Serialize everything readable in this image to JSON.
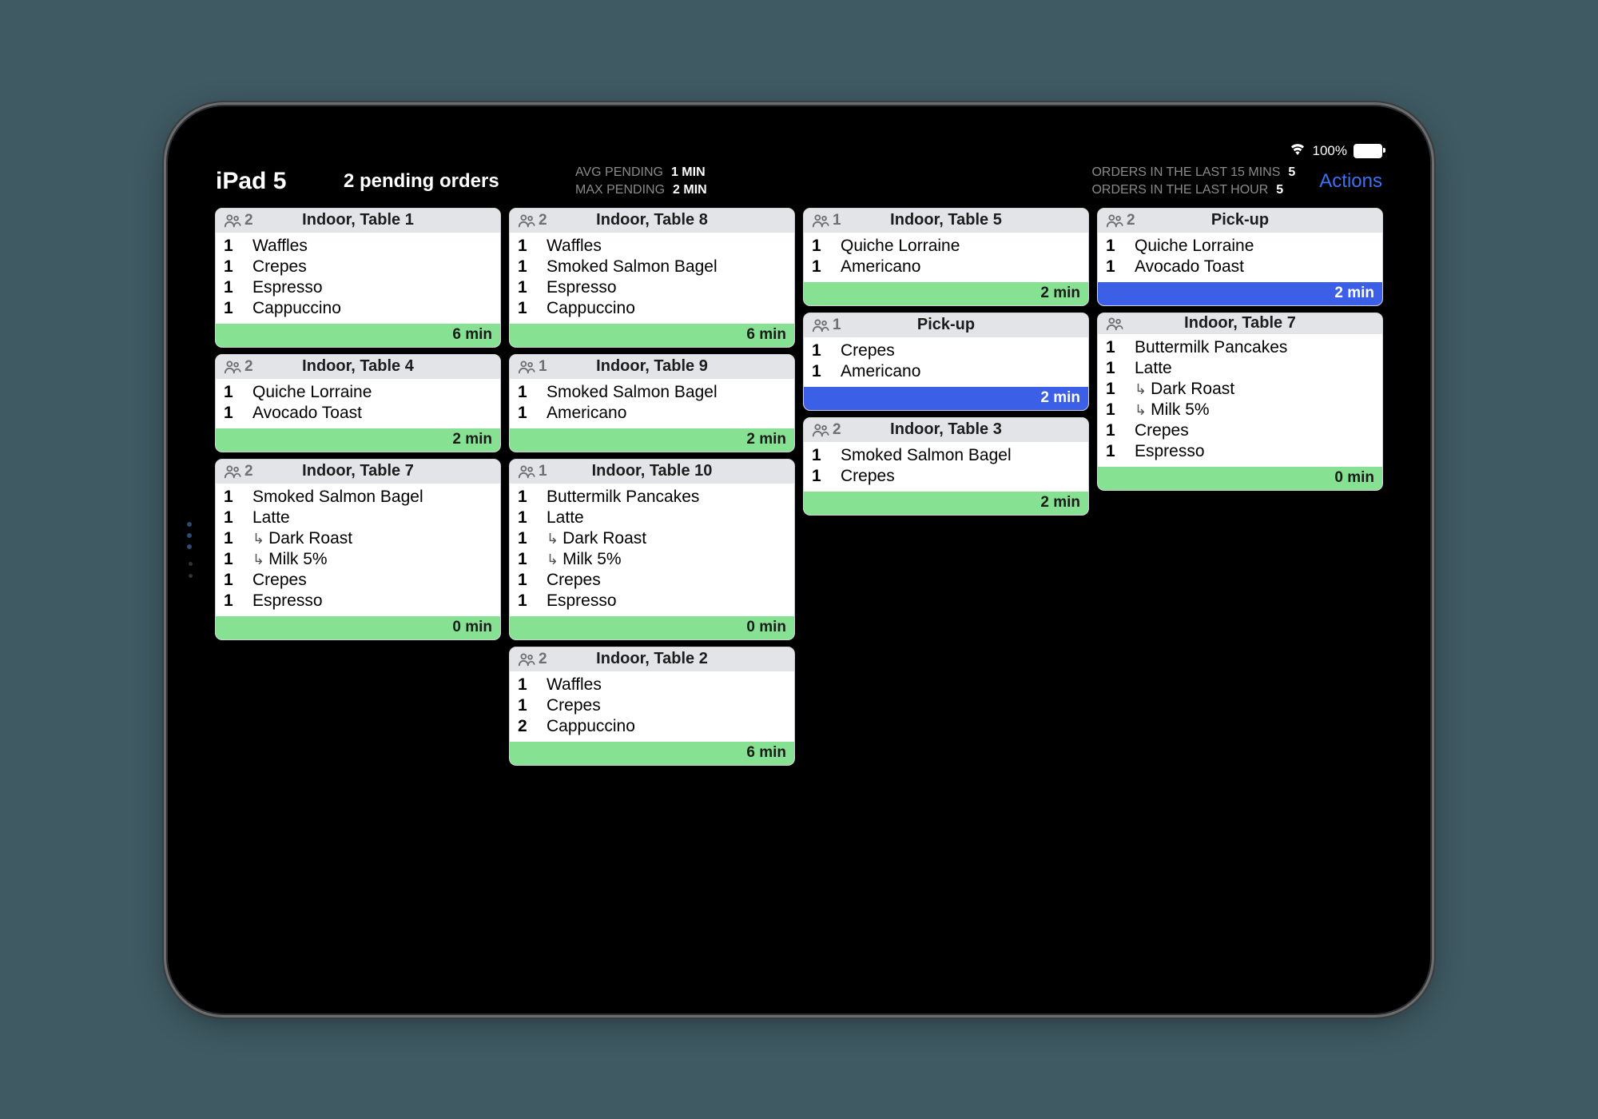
{
  "statusbar": {
    "battery_percent": "100%"
  },
  "header": {
    "device_name": "iPad 5",
    "pending_orders": "2 pending orders",
    "avg_label": "AVG PENDING",
    "avg_value": "1 MIN",
    "max_label": "MAX PENDING",
    "max_value": "2 MIN",
    "last15_label": "ORDERS IN THE LAST 15 MINS",
    "last15_value": "5",
    "lasthour_label": "ORDERS IN THE LAST HOUR",
    "lasthour_value": "5",
    "actions_label": "Actions"
  },
  "colors": {
    "accent_link": "#3a72f3",
    "footer_green": "#86e292",
    "footer_blue": "#3c5fe8"
  },
  "columns": [
    [
      {
        "guests": "2",
        "title": "Indoor, Table 1",
        "footer_style": "green",
        "footer_text": "6 min",
        "items": [
          {
            "qty": "1",
            "name": "Waffles"
          },
          {
            "qty": "1",
            "name": "Crepes"
          },
          {
            "qty": "1",
            "name": "Espresso"
          },
          {
            "qty": "1",
            "name": "Cappuccino"
          }
        ]
      },
      {
        "guests": "2",
        "title": "Indoor, Table 4",
        "footer_style": "green",
        "footer_text": "2 min",
        "items": [
          {
            "qty": "1",
            "name": "Quiche Lorraine"
          },
          {
            "qty": "1",
            "name": "Avocado Toast"
          }
        ]
      },
      {
        "guests": "2",
        "title": "Indoor, Table 7",
        "footer_style": "green",
        "footer_text": "0 min",
        "items": [
          {
            "qty": "1",
            "name": "Smoked Salmon Bagel"
          },
          {
            "qty": "1",
            "name": "Latte"
          },
          {
            "qty": "1",
            "name": "Dark Roast",
            "mod": true
          },
          {
            "qty": "1",
            "name": "Milk 5%",
            "mod": true
          },
          {
            "qty": "1",
            "name": "Crepes"
          },
          {
            "qty": "1",
            "name": "Espresso"
          }
        ]
      }
    ],
    [
      {
        "guests": "2",
        "title": "Indoor, Table 8",
        "footer_style": "green",
        "footer_text": "6 min",
        "items": [
          {
            "qty": "1",
            "name": "Waffles"
          },
          {
            "qty": "1",
            "name": "Smoked Salmon Bagel"
          },
          {
            "qty": "1",
            "name": "Espresso"
          },
          {
            "qty": "1",
            "name": "Cappuccino"
          }
        ]
      },
      {
        "guests": "1",
        "title": "Indoor, Table 9",
        "footer_style": "green",
        "footer_text": "2 min",
        "items": [
          {
            "qty": "1",
            "name": "Smoked Salmon Bagel"
          },
          {
            "qty": "1",
            "name": "Americano"
          }
        ]
      },
      {
        "guests": "1",
        "title": "Indoor, Table 10",
        "footer_style": "green",
        "footer_text": "0 min",
        "items": [
          {
            "qty": "1",
            "name": "Buttermilk Pancakes"
          },
          {
            "qty": "1",
            "name": "Latte"
          },
          {
            "qty": "1",
            "name": "Dark Roast",
            "mod": true
          },
          {
            "qty": "1",
            "name": "Milk 5%",
            "mod": true
          },
          {
            "qty": "1",
            "name": "Crepes"
          },
          {
            "qty": "1",
            "name": "Espresso"
          }
        ]
      },
      {
        "guests": "2",
        "title": "Indoor, Table 2",
        "footer_style": "green",
        "footer_text": "6 min",
        "items": [
          {
            "qty": "1",
            "name": "Waffles"
          },
          {
            "qty": "1",
            "name": "Crepes"
          },
          {
            "qty": "2",
            "name": "Cappuccino"
          }
        ]
      }
    ],
    [
      {
        "guests": "1",
        "title": "Indoor, Table 5",
        "footer_style": "green",
        "footer_text": "2 min",
        "items": [
          {
            "qty": "1",
            "name": "Quiche Lorraine"
          },
          {
            "qty": "1",
            "name": "Americano"
          }
        ]
      },
      {
        "guests": "1",
        "title": "Pick-up",
        "footer_style": "blue",
        "footer_text": "2 min",
        "items": [
          {
            "qty": "1",
            "name": "Crepes"
          },
          {
            "qty": "1",
            "name": "Americano"
          }
        ]
      },
      {
        "guests": "2",
        "title": "Indoor, Table 3",
        "footer_style": "green",
        "footer_text": "2 min",
        "items": [
          {
            "qty": "1",
            "name": "Smoked Salmon Bagel"
          },
          {
            "qty": "1",
            "name": "Crepes"
          }
        ]
      }
    ],
    [
      {
        "guests": "2",
        "title": "Pick-up",
        "footer_style": "blue",
        "footer_text": "2 min",
        "items": [
          {
            "qty": "1",
            "name": "Quiche Lorraine"
          },
          {
            "qty": "1",
            "name": "Avocado Toast"
          }
        ]
      },
      {
        "guests": "",
        "title": "Indoor, Table 7",
        "footer_style": "green",
        "footer_text": "0 min",
        "items": [
          {
            "qty": "1",
            "name": "Buttermilk Pancakes"
          },
          {
            "qty": "1",
            "name": "Latte"
          },
          {
            "qty": "1",
            "name": "Dark Roast",
            "mod": true
          },
          {
            "qty": "1",
            "name": "Milk 5%",
            "mod": true
          },
          {
            "qty": "1",
            "name": "Crepes"
          },
          {
            "qty": "1",
            "name": "Espresso"
          }
        ]
      }
    ]
  ]
}
